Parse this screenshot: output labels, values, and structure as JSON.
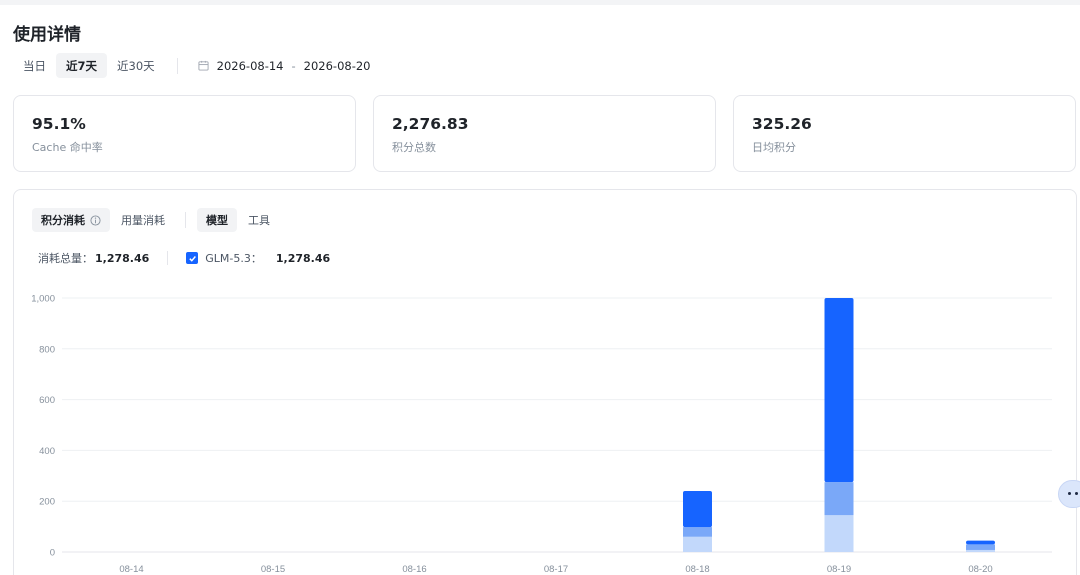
{
  "page": {
    "title": "使用详情"
  },
  "range": {
    "options": [
      "当日",
      "近7天",
      "近30天"
    ],
    "active": "近7天",
    "start_date": "2026-08-14",
    "separator": "-",
    "end_date": "2026-08-20"
  },
  "stats": [
    {
      "value": "95.1%",
      "label": "Cache 命中率"
    },
    {
      "value": "2,276.83",
      "label": "积分总数"
    },
    {
      "value": "325.26",
      "label": "日均积分"
    }
  ],
  "panel": {
    "tabs": [
      {
        "label": "积分消耗",
        "active": true
      },
      {
        "label": "用量消耗",
        "active": false
      }
    ],
    "group_tabs": [
      {
        "label": "模型",
        "active": true
      },
      {
        "label": "工具",
        "active": false
      }
    ],
    "summary": {
      "total_label": "消耗总量：",
      "total_value": "1,278.46",
      "model_name": "GLM-5.3：",
      "model_value": "1,278.46",
      "model_checked": true
    }
  },
  "chart_data": {
    "type": "bar",
    "stacked": true,
    "categories": [
      "08-14",
      "08-15",
      "08-16",
      "08-17",
      "08-18",
      "08-19",
      "08-20"
    ],
    "series": [
      {
        "values": [
          0,
          0,
          0,
          0,
          60,
          145,
          8
        ],
        "color": "#c2d8fb"
      },
      {
        "values": [
          0,
          0,
          0,
          0,
          38,
          130,
          22
        ],
        "color": "#7aa8f8"
      },
      {
        "values": [
          0,
          0,
          0,
          0,
          142,
          725,
          15
        ],
        "color": "#1664ff"
      }
    ],
    "ylim": [
      0,
      1000
    ],
    "yticks": [
      "0",
      "200",
      "400",
      "600",
      "800",
      "1,000"
    ],
    "ytick_values": [
      0,
      200,
      400,
      600,
      800,
      1000
    ],
    "grid": true,
    "legend": "none"
  },
  "icons": {
    "calendar": "calendar-icon",
    "info": "info-icon",
    "check": "check-icon",
    "assistant": "assistant-bubble-icon"
  },
  "colors": {
    "accent": "#1664ff"
  }
}
